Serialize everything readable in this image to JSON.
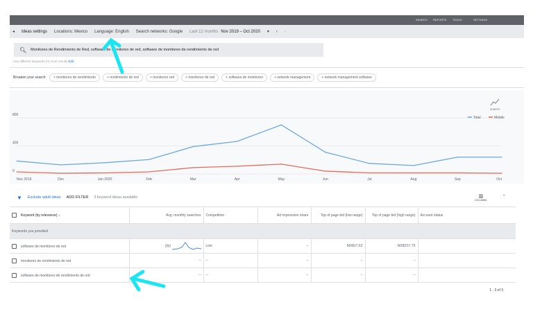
{
  "topbar": {
    "items": [
      "SEARCH",
      "REPORTS",
      "TOOLS",
      "SETTINGS"
    ]
  },
  "toolbar": {
    "ideas_settings": "Ideas settings",
    "locations": "Locations: Mexico",
    "language": "Language: English",
    "networks": "Search networks: Google",
    "range_label": "Last 12 months",
    "range": "Nov 2019 – Oct 2020"
  },
  "search": {
    "value": "Monitoreo de Rendimiento de Red, software de monitoreo de red, software de monitoreo de rendimiento de red",
    "hint": "Use different keywords for more results",
    "edit": "Edit"
  },
  "broaden": {
    "label": "Broaden your search:",
    "chips": [
      "monitoreo de rendimiento",
      "rendimiento de red",
      "monitoreo red",
      "monitoreo de red",
      "software de monitoreo",
      "network management",
      "network management software"
    ]
  },
  "chart_data": {
    "type": "line",
    "x": [
      "Nov 2019",
      "Dec",
      "Jan 2020",
      "Feb",
      "Mar",
      "Apr",
      "May",
      "Jun",
      "Jul",
      "Aug",
      "Sep",
      "Oct"
    ],
    "yticks": [
      0,
      400,
      800
    ],
    "ylim": [
      0,
      900
    ],
    "legend_placement": "top-right",
    "grid": true,
    "charts_label": "CHARTS",
    "series": [
      {
        "name": "Total",
        "color": "#6aa8e0",
        "values": [
          185,
          130,
          160,
          205,
          390,
          465,
          700,
          310,
          150,
          120,
          240,
          240
        ]
      },
      {
        "name": "Mobile",
        "color": "#e06b5a",
        "values": [
          30,
          10,
          15,
          30,
          90,
          110,
          140,
          40,
          15,
          15,
          15,
          10
        ]
      }
    ]
  },
  "filter": {
    "exclude": "Exclude adult ideas",
    "add": "ADD FILTER",
    "count": "3 keyword ideas available",
    "columns": "COLUMNS"
  },
  "table": {
    "headers": [
      "Keyword (by relevance)",
      "Avg. monthly searches",
      "Competition",
      "Ad impression share",
      "Top of page bid (low range)",
      "Top of page bid (high range)",
      "Account status"
    ],
    "group": "Keywords you provided",
    "rows": [
      [
        "software de monitoreo de red",
        "260",
        "Low",
        "–",
        "MX$17.62",
        "MX$157.75",
        ""
      ],
      [
        "monitoreo de rendimiento de red",
        "–",
        "–",
        "–",
        "–",
        "–",
        ""
      ],
      [
        "software de monitoreo de rendimiento de red",
        "–",
        "–",
        "–",
        "–",
        "–",
        ""
      ]
    ]
  },
  "footer": {
    "pagination": "1 - 3 of 3"
  }
}
